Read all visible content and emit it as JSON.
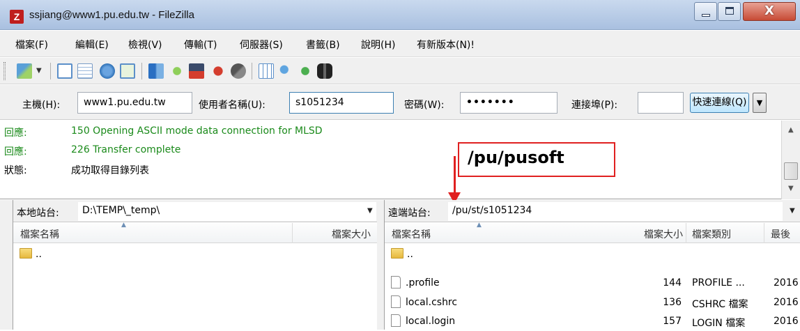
{
  "window": {
    "title": "ssjiang@www1.pu.edu.tw - FileZilla",
    "app_icon_letter": "Z",
    "close_glyph": "X"
  },
  "menu": [
    "檔案(F)",
    "編輯(E)",
    "檢視(V)",
    "傳輸(T)",
    "伺服器(S)",
    "書籤(B)",
    "說明(H)",
    "有新版本(N)!"
  ],
  "toolbar": {
    "icons": [
      "site-manager-icon",
      "dropdown-icon",
      "message-log-toggle-icon",
      "local-tree-toggle-icon",
      "remote-tree-toggle-icon",
      "transfer-queue-toggle-icon",
      "refresh-icon",
      "process-queue-icon",
      "cancel-icon",
      "disconnect-icon",
      "reconnect-icon",
      "directory-listing-filter-icon",
      "compare-icon",
      "sync-browse-icon",
      "search-icon"
    ]
  },
  "quickconnect": {
    "host_label": "主機(H):",
    "host_value": "www1.pu.edu.tw",
    "user_label": "使用者名稱(U):",
    "user_value": "s1051234",
    "password_label": "密碼(W):",
    "password_value": "•••••••",
    "port_label": "連接埠(P):",
    "port_value": "",
    "button_label": "快速連線(Q)",
    "dropdown_glyph": "▼"
  },
  "log": [
    {
      "label": "回應:",
      "message": "150 Opening ASCII mode data connection for MLSD",
      "type": "response"
    },
    {
      "label": "回應:",
      "message": "226 Transfer complete",
      "type": "response"
    },
    {
      "label": "狀態:",
      "message": "成功取得目錄列表",
      "type": "status"
    }
  ],
  "annotation": {
    "text": "/pu/pusoft",
    "color": "#e02020"
  },
  "local": {
    "site_label": "本地站台:",
    "path": "D:\\TEMP\\_temp\\",
    "columns": {
      "name": "檔案名稱",
      "size": "檔案大小"
    },
    "rows": [
      {
        "name": "..",
        "kind": "folder"
      }
    ]
  },
  "remote": {
    "site_label": "遠端站台:",
    "path": "/pu/st/s1051234",
    "columns": {
      "name": "檔案名稱",
      "size": "檔案大小",
      "type": "檔案類別",
      "modified": "最後"
    },
    "rows": [
      {
        "name": "..",
        "kind": "folder",
        "size": "",
        "type": "",
        "modified": ""
      },
      {
        "name": ".profile",
        "kind": "file",
        "size": "144",
        "type": "PROFILE ...",
        "modified": "2016"
      },
      {
        "name": "local.cshrc",
        "kind": "file",
        "size": "136",
        "type": "CSHRC 檔案",
        "modified": "2016"
      },
      {
        "name": "local.login",
        "kind": "file",
        "size": "157",
        "type": "LOGIN 檔案",
        "modified": "2016"
      }
    ]
  }
}
